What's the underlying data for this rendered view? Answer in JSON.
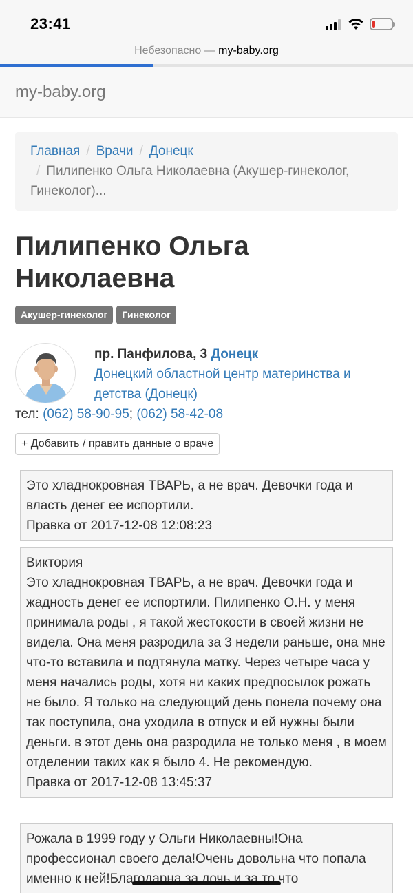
{
  "status_bar": {
    "time": "23:41",
    "battery_level": 0.15,
    "battery_color": "#e0322b"
  },
  "browser": {
    "insecure_label": "Небезопасно",
    "separator": " — ",
    "domain": "my-baby.org",
    "load_progress": 0.37
  },
  "navbar": {
    "brand": "my-baby.org"
  },
  "breadcrumb": {
    "items": [
      "Главная",
      "Врачи",
      "Донецк"
    ],
    "separator": "/",
    "current": "Пилипенко Ольга Николаевна (Акушер-гинеколог, Гинеколог)..."
  },
  "doctor": {
    "name": "Пилипенко Ольга Николаевна",
    "specialties": [
      "Акушер-гинеколог",
      "Гинеколог"
    ],
    "address_street": "пр. Панфилова, 3",
    "address_city": "Донецк",
    "clinic": "Донецкий областной центр материнства и детства (Донецк)",
    "phone_label": "тел:",
    "phones": [
      "(062) 58-90-95",
      "(062) 58-42-08"
    ],
    "phone_separator": ";",
    "add_button": "+ Добавить / править данные о враче"
  },
  "reviews": [
    {
      "author": "",
      "text": "Это хладнокровная ТВАРЬ, а не врач. Девочки года и власть денег ее испортили.",
      "edit": "Правка от 2017-12-08 12:08:23"
    },
    {
      "author": "Виктория",
      "text": "Это хладнокровная ТВАРЬ, а не врач. Девочки года и жадность денег ее испортили. Пилипенко О.Н. у меня принимала роды , я такой жестокости в своей жизни не видела. Она меня разродила за 3 недели раньше, она мне что-то вставила и подтянула матку. Через четыре часа у меня начались роды, хотя ни каких предпосылок рожать не было. Я только на следующий день понела почему она так поступила, она уходила в отпуск и ей нужны были деньги. в этот день она разродила не только меня , в моем отделении таких как я было 4. Не рекомендую.",
      "edit": "Правка от 2017-12-08 13:45:37"
    },
    {
      "author": "",
      "text": "Рожала в 1999 году у Ольги Николаевны!Она профессионал своего дела!Очень довольна что попала именно к ней!Благодарна за дочь и за то что",
      "edit": ""
    }
  ]
}
